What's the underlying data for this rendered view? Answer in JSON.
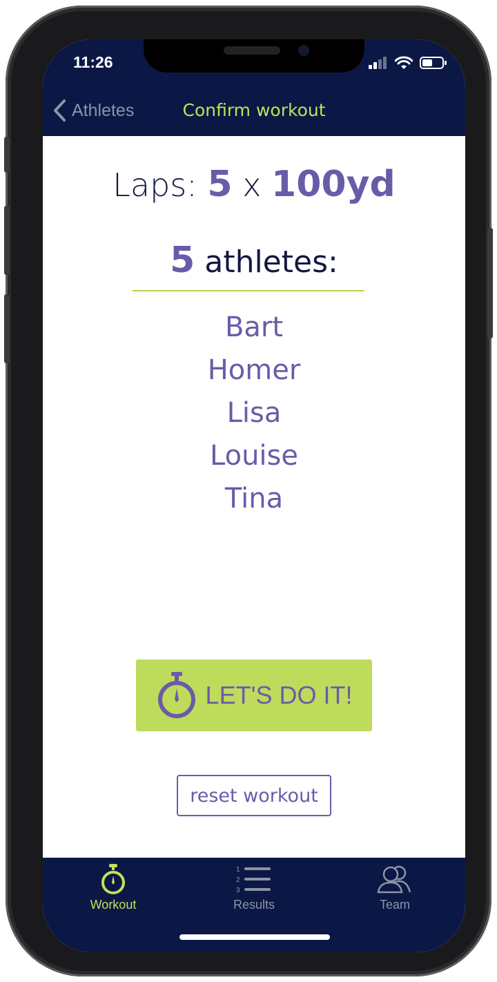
{
  "status": {
    "time": "11:26",
    "icons": [
      "cellular-signal-icon",
      "wifi-icon",
      "battery-icon"
    ]
  },
  "nav": {
    "back_label": "Athletes",
    "title": "Confirm workout"
  },
  "workout": {
    "laps_label": "Laps:",
    "laps_count": "5",
    "times": "x",
    "distance": "100yd",
    "athlete_count": "5",
    "athletes_label": "athletes:",
    "athletes": [
      "Bart",
      "Homer",
      "Lisa",
      "Louise",
      "Tina"
    ]
  },
  "actions": {
    "go_label": "LET'S DO IT!",
    "reset_label": "reset workout"
  },
  "tabs": [
    {
      "label": "Workout",
      "icon": "stopwatch-icon",
      "active": true
    },
    {
      "label": "Results",
      "icon": "ranked-list-icon",
      "active": false
    },
    {
      "label": "Team",
      "icon": "team-icon",
      "active": false
    }
  ],
  "colors": {
    "nav_bg": "#0b1845",
    "accent_green": "#bfdb5b",
    "accent_purple": "#6a5ba9",
    "inactive_gray": "#8d93a8"
  }
}
